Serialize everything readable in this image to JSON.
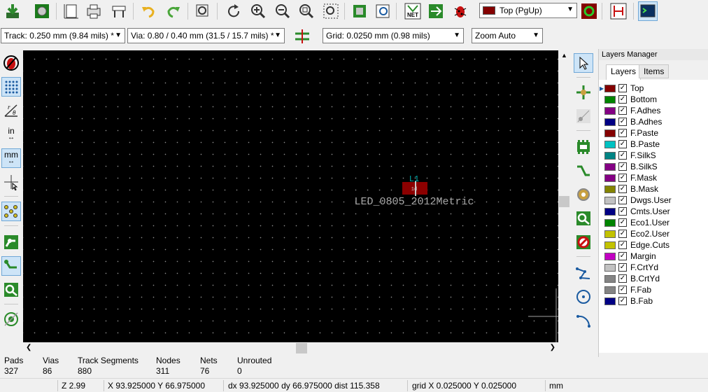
{
  "toolbar": {
    "active_layer": "Top (PgUp)",
    "active_layer_color": "#840000"
  },
  "toolbar2": {
    "track": "Track: 0.250 mm (9.84 mils) *",
    "via": "Via: 0.80 / 0.40 mm (31.5 / 15.7 mils) *",
    "grid": "Grid: 0.0250 mm (0.98 mils)",
    "zoom": "Zoom Auto"
  },
  "left_toolbar": {
    "units_in": "in",
    "units_mm": "mm"
  },
  "canvas": {
    "footprint_ref": "L1",
    "footprint_value": "LED_0805_2012Metric",
    "pad_label": "1d"
  },
  "layers_manager": {
    "title": "Layers Manager",
    "tabs": [
      "Layers",
      "Items"
    ],
    "layers": [
      {
        "name": "Top",
        "color": "#840000"
      },
      {
        "name": "Bottom",
        "color": "#008400"
      },
      {
        "name": "F.Adhes",
        "color": "#840084"
      },
      {
        "name": "B.Adhes",
        "color": "#000084"
      },
      {
        "name": "F.Paste",
        "color": "#840000"
      },
      {
        "name": "B.Paste",
        "color": "#00c2c2"
      },
      {
        "name": "F.SilkS",
        "color": "#008484"
      },
      {
        "name": "B.SilkS",
        "color": "#840084"
      },
      {
        "name": "F.Mask",
        "color": "#840084"
      },
      {
        "name": "B.Mask",
        "color": "#848400"
      },
      {
        "name": "Dwgs.User",
        "color": "#c2c2c2"
      },
      {
        "name": "Cmts.User",
        "color": "#000084"
      },
      {
        "name": "Eco1.User",
        "color": "#008400"
      },
      {
        "name": "Eco2.User",
        "color": "#c2c200"
      },
      {
        "name": "Edge.Cuts",
        "color": "#c2c200"
      },
      {
        "name": "Margin",
        "color": "#c200c2"
      },
      {
        "name": "F.CrtYd",
        "color": "#c2c2c2"
      },
      {
        "name": "B.CrtYd",
        "color": "#848484"
      },
      {
        "name": "F.Fab",
        "color": "#848484"
      },
      {
        "name": "B.Fab",
        "color": "#000084"
      }
    ]
  },
  "stats": {
    "pads_label": "Pads",
    "pads": "327",
    "vias_label": "Vias",
    "vias": "86",
    "tracks_label": "Track Segments",
    "tracks": "880",
    "nodes_label": "Nodes",
    "nodes": "311",
    "nets_label": "Nets",
    "nets": "76",
    "unrouted_label": "Unrouted",
    "unrouted": "0"
  },
  "status": {
    "zoom": "Z 2.99",
    "xy": "X 93.925000  Y 66.975000",
    "dxy": "dx 93.925000  dy 66.975000  dist 115.358",
    "grid": "grid X 0.025000  Y 0.025000",
    "units": "mm"
  },
  "icons": {
    "top": [
      "save-icon",
      "board-setup-icon",
      "page-settings-icon",
      "plot-icon",
      "print-icon",
      "footprint-editor-icon",
      "undo-icon",
      "redo-icon",
      "find-icon",
      "refresh-icon",
      "zoom-in-icon",
      "zoom-out-icon",
      "zoom-fit-icon",
      "zoom-selection-icon",
      "footprint-library-icon",
      "footprint-browser-icon",
      "netlist-icon",
      "interactive-router-icon",
      "drc-bug-icon",
      "layer-pair-icon",
      "autoroute-icon",
      "scripting-console-icon"
    ]
  }
}
